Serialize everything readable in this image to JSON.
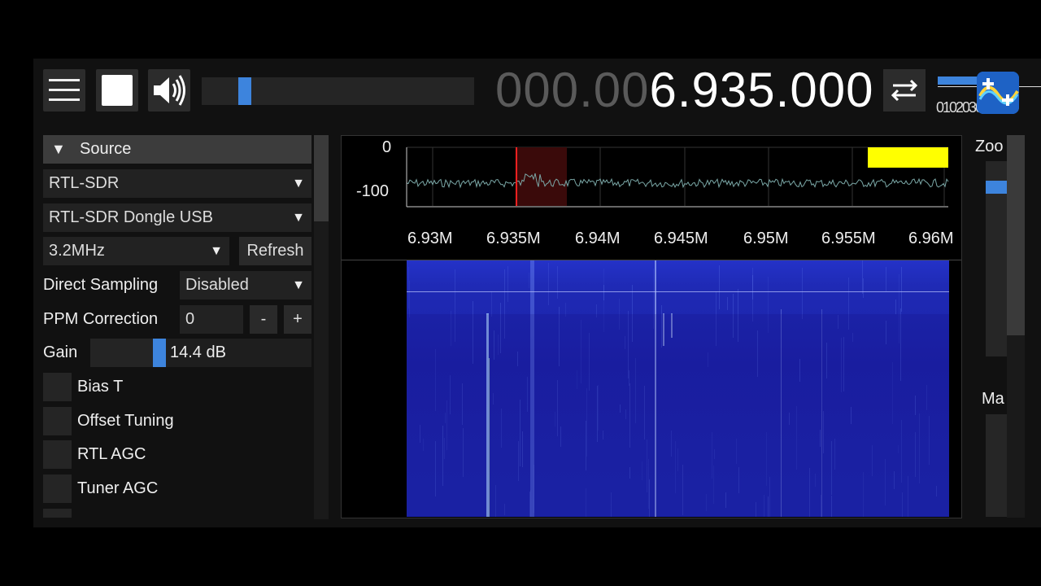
{
  "topbar": {
    "menu_icon": "hamburger-menu-icon",
    "stop_icon": "stop-icon",
    "volume_icon": "speaker-icon",
    "volume_level": 0.14,
    "frequency_dim": "000.00",
    "frequency_bright": "6.935.000",
    "swap_icon": "swap-arrows-icon",
    "scale_ticks": "0102030",
    "logo_icon": "app-logo-icon"
  },
  "source_panel": {
    "header": "Source",
    "header_arrow": "▼",
    "device_type": "RTL-SDR",
    "device": "RTL-SDR Dongle USB",
    "sample_rate": "3.2MHz",
    "refresh_label": "Refresh",
    "direct_sampling_label": "Direct Sampling",
    "direct_sampling_value": "Disabled",
    "ppm_label": "PPM Correction",
    "ppm_value": "0",
    "ppm_minus": "-",
    "ppm_plus": "+",
    "gain_label": "Gain",
    "gain_value": "14.4 dB",
    "gain_level": 0.3,
    "checkboxes": [
      "Bias T",
      "Offset Tuning",
      "RTL AGC",
      "Tuner AGC"
    ],
    "caret": "▼"
  },
  "spectrum": {
    "y_labels": [
      "0",
      "-100"
    ],
    "x_labels": [
      "6.93M",
      "6.935M",
      "6.94M",
      "6.945M",
      "6.95M",
      "6.955M",
      "6.96M"
    ],
    "tuned_color": "#ff2020",
    "trace_color": "#7aa7a6",
    "marker_color": "#ffff00"
  },
  "right_panel": {
    "zoom_label": "Zoo",
    "max_label": "Ma"
  },
  "colors": {
    "accent": "#3d84dd",
    "waterfall_bg": "#1f2ab5"
  }
}
